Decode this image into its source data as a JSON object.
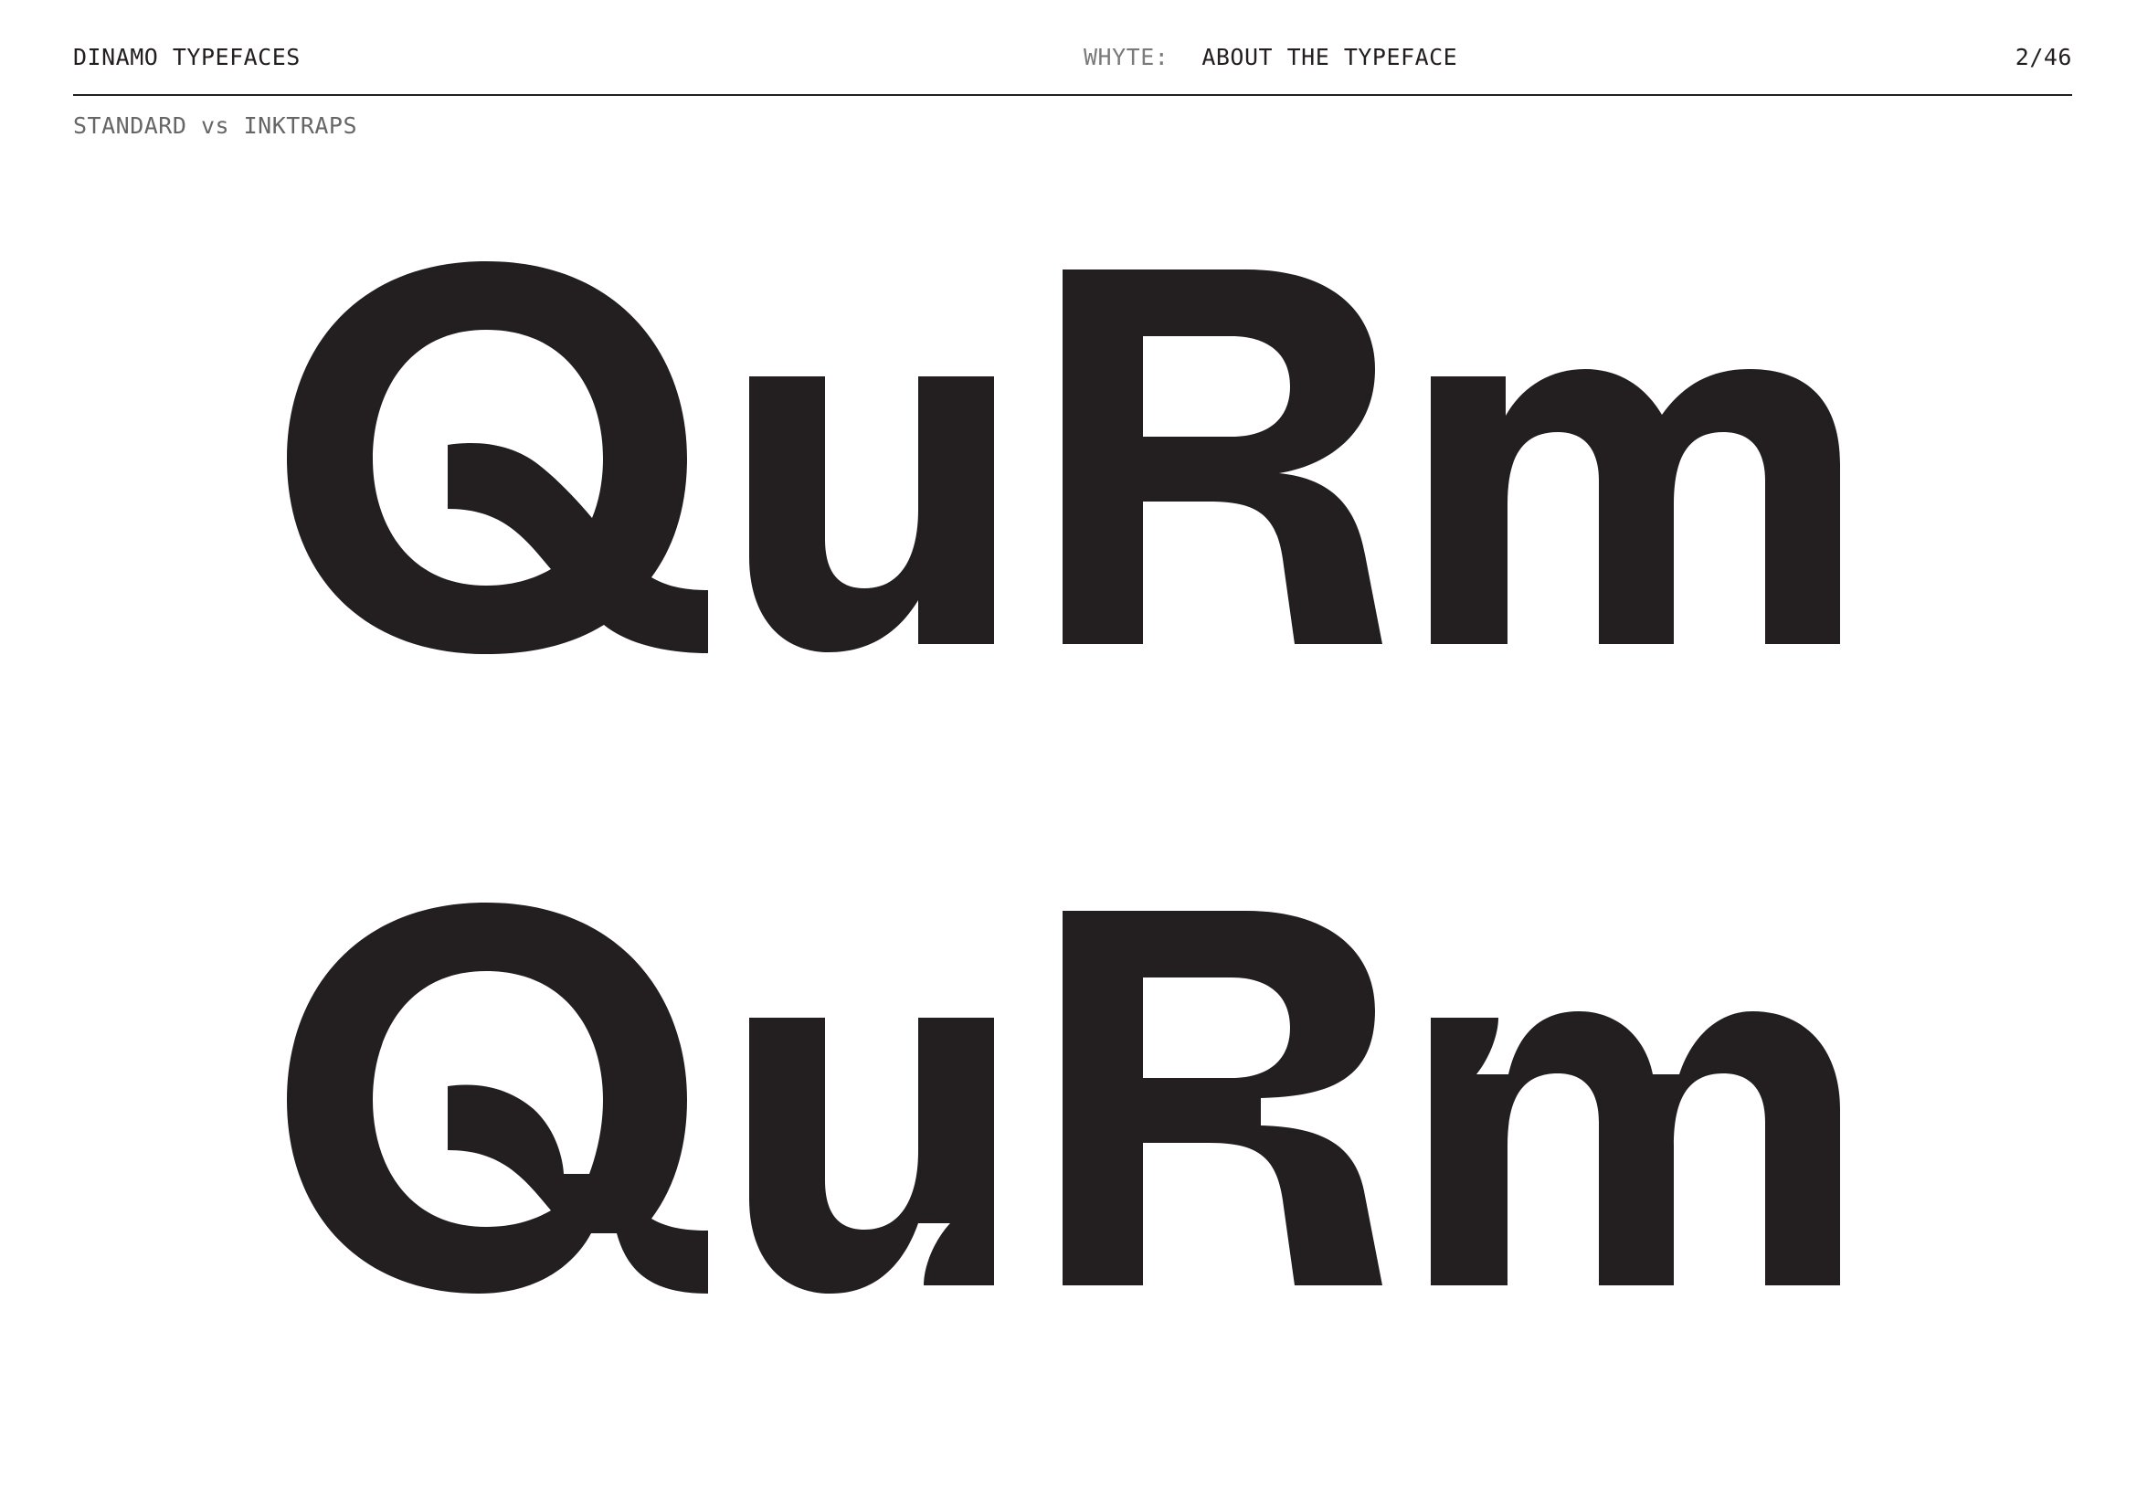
{
  "header": {
    "foundry": "DINAMO TYPEFACES",
    "section_label": "WHYTE:",
    "section_title": "ABOUT THE TYPEFACE",
    "page_number": "2/46"
  },
  "subheading": "STANDARD vs INKTRAPS",
  "specimens": [
    {
      "name": "standard",
      "text": "QuRm"
    },
    {
      "name": "inktraps",
      "text": "QuRm"
    }
  ],
  "colors": {
    "ink": "#231f20",
    "muted": "#7a7a7a",
    "background": "#ffffff"
  }
}
